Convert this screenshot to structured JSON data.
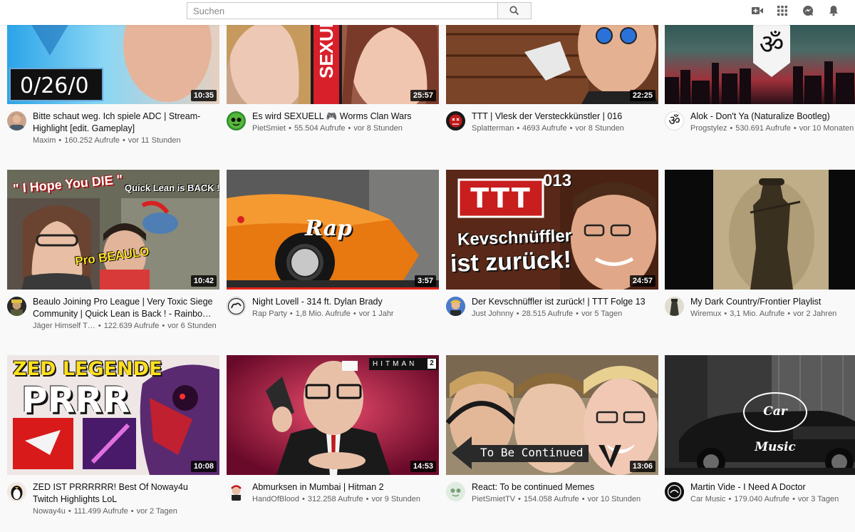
{
  "search": {
    "placeholder": "Suchen"
  },
  "header_icons": [
    "video-camera-icon",
    "apps-grid-icon",
    "messages-icon",
    "notifications-bell-icon"
  ],
  "videos": [
    {
      "title": "Bitte schaut weg. Ich spiele ADC | Stream-Highlight [edit. Gameplay]",
      "channel": "Maxim",
      "views": "160.252 Aufrufe",
      "age": "vor 11 Stunden",
      "duration": "10:35",
      "thumb_text": "0/26/0"
    },
    {
      "title": "Es wird SEXUELL 🎮 Worms Clan Wars",
      "channel": "PietSmiet",
      "views": "55.504 Aufrufe",
      "age": "vor 8 Stunden",
      "duration": "25:57",
      "thumb_text": "SEXUE"
    },
    {
      "title": "TTT | Vlesk der Versteckkünstler | 016",
      "channel": "Splatterman",
      "views": "4693 Aufrufe",
      "age": "vor 8 Stunden",
      "duration": "22:25",
      "thumb_text": ""
    },
    {
      "title": "Alok - Don't Ya (Naturalize Bootleg)",
      "channel": "Progstylez",
      "views": "530.691 Aufrufe",
      "age": "vor 10 Monaten",
      "duration": "",
      "thumb_text": "ॐ"
    },
    {
      "title": "Beaulo Joining Pro League | Very Toxic Siege Community | Quick Lean is Back ! - Rainbo…",
      "channel": "Jäger Himself T…",
      "views": "122.639 Aufrufe",
      "age": "vor 6 Stunden",
      "duration": "10:42",
      "thumb_text": "\" I Hope You DIE \"",
      "thumb_text2": "Quick Lean is BACK !!",
      "thumb_text3": "Pro BEAULO"
    },
    {
      "title": "Night Lovell - 314 ft. Dylan Brady",
      "channel": "Rap Party",
      "views": "1,8 Mio. Aufrufe",
      "age": "vor 1 Jahr",
      "duration": "3:57",
      "thumb_text": "Rap"
    },
    {
      "title": "Der Kevschnüffler ist zurück! | TTT Folge 13",
      "channel": "Just Johnny",
      "views": "28.515 Aufrufe",
      "age": "vor 5 Tagen",
      "duration": "24:57",
      "thumb_text": "TTT",
      "thumb_text2": "013",
      "thumb_text3": "Kevschnüffler",
      "thumb_text4": "ist zurück!"
    },
    {
      "title": "My Dark Country/Frontier Playlist",
      "channel": "Wiremux",
      "views": "3,1 Mio. Aufrufe",
      "age": "vor 2 Jahren",
      "duration": "",
      "thumb_text": ""
    },
    {
      "title": "ZED IST PRRRRRR! Best Of Noway4u Twitch Highlights LoL",
      "channel": "Noway4u",
      "views": "111.499 Aufrufe",
      "age": "vor 2 Tagen",
      "duration": "10:08",
      "thumb_text": "ZED LEGENDE",
      "thumb_text2": "PRRR"
    },
    {
      "title": "Abmurksen in Mumbai | Hitman 2",
      "channel": "HandOfBlood",
      "views": "312.258 Aufrufe",
      "age": "vor 9 Stunden",
      "duration": "14:53",
      "thumb_text": "HITMAN",
      "thumb_text2": "2"
    },
    {
      "title": "React: To be continued Memes",
      "channel": "PietSmietTV",
      "views": "154.058 Aufrufe",
      "age": "vor 10 Stunden",
      "duration": "13:06",
      "thumb_text": "To Be Continued"
    },
    {
      "title": "Martin Vide - I Need A Doctor",
      "channel": "Car Music",
      "views": "179.040 Aufrufe",
      "age": "vor 3 Tagen",
      "duration": "",
      "thumb_text": "Car Music"
    }
  ]
}
